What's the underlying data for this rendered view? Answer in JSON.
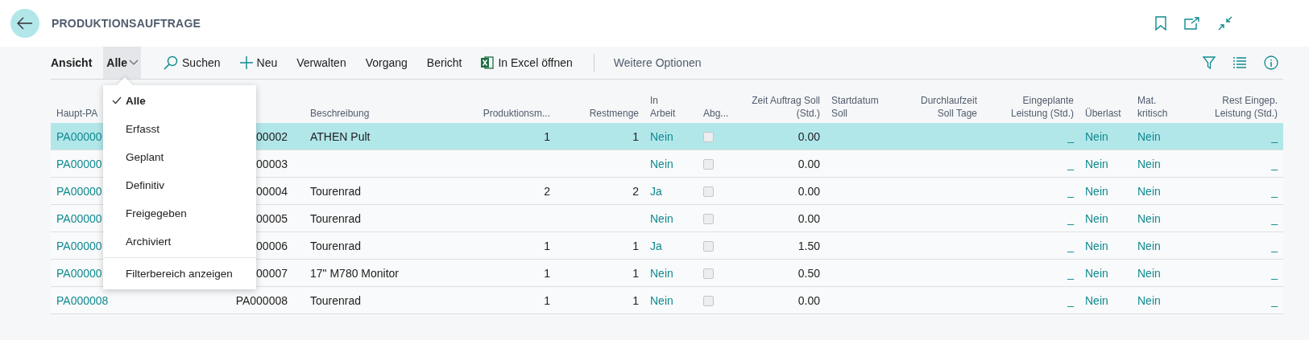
{
  "page": {
    "title": "PRODUKTIONSAUFTRAGE"
  },
  "toolbar": {
    "items": [
      {
        "kind": "label",
        "label": "Ansicht"
      },
      {
        "kind": "dropdown",
        "label": "Alle",
        "expanded": true
      },
      {
        "kind": "search",
        "label": "Suchen"
      },
      {
        "kind": "new",
        "label": "Neu"
      },
      {
        "kind": "text",
        "label": "Verwalten"
      },
      {
        "kind": "text",
        "label": "Vorgang"
      },
      {
        "kind": "text",
        "label": "Bericht"
      },
      {
        "kind": "excel",
        "label": "In Excel öffnen"
      },
      {
        "kind": "more",
        "label": "Weitere Optionen"
      }
    ]
  },
  "view_menu": {
    "items": [
      {
        "label": "Alle",
        "selected": true
      },
      {
        "label": "Erfasst",
        "selected": false
      },
      {
        "label": "Geplant",
        "selected": false
      },
      {
        "label": "Definitiv",
        "selected": false
      },
      {
        "label": "Freigegeben",
        "selected": false
      },
      {
        "label": "Archiviert",
        "selected": false
      }
    ],
    "footer": "Filterbereich anzeigen"
  },
  "table": {
    "columns": [
      {
        "label": "Haupt-PA",
        "kind": "link"
      },
      {
        "kind": "text"
      },
      {
        "kind": "code"
      },
      {
        "label": "Beschreibung",
        "kind": "text"
      },
      {
        "label": "Produktionsm...",
        "kind": "number"
      },
      {
        "label": "Restmenge",
        "kind": "number"
      },
      {
        "label": "In\nArbeit",
        "kind": "link"
      },
      {
        "label": "Abg...",
        "kind": "checkbox"
      },
      {
        "label": "Zeit Auftrag Soll\n(Std.)",
        "kind": "number"
      },
      {
        "label": "Startdatum\nSoll",
        "kind": "text"
      },
      {
        "label": "Durchlaufzeit\nSoll Tage",
        "kind": "number"
      },
      {
        "label": "Eingeplante\nLeistung (Std.)",
        "kind": "numlink"
      },
      {
        "label": "Überlast",
        "kind": "link"
      },
      {
        "label": "Mat.\nkritisch",
        "kind": "link"
      },
      {
        "label": "Rest Eingep.\nLeistung (Std.)",
        "kind": "numlink"
      }
    ],
    "rows": [
      {
        "selected": true,
        "cells": [
          "PA00000",
          null,
          "00002",
          "ATHEN Pult",
          "1",
          "1",
          "Nein",
          false,
          "0.00",
          null,
          null,
          "_",
          "Nein",
          "Nein",
          "_"
        ]
      },
      {
        "selected": false,
        "cells": [
          "PA00000",
          null,
          "00003",
          null,
          null,
          null,
          "Nein",
          false,
          "0.00",
          null,
          null,
          "_",
          "Nein",
          "Nein",
          "_"
        ]
      },
      {
        "selected": false,
        "cells": [
          "PA00000",
          null,
          "00004",
          "Tourenrad",
          "2",
          "2",
          "Ja",
          false,
          "0.00",
          null,
          null,
          "_",
          "Nein",
          "Nein",
          "_"
        ]
      },
      {
        "selected": false,
        "cells": [
          "PA00000",
          null,
          "00005",
          "Tourenrad",
          null,
          null,
          "Nein",
          false,
          "0.00",
          null,
          null,
          "_",
          "Nein",
          "Nein",
          "_"
        ]
      },
      {
        "selected": false,
        "cells": [
          "PA00000",
          null,
          "00006",
          "Tourenrad",
          "1",
          "1",
          "Ja",
          false,
          "1.50",
          null,
          null,
          "_",
          "Nein",
          "Nein",
          "_"
        ]
      },
      {
        "selected": false,
        "cells": [
          "PA00000",
          null,
          "00007",
          "17\" M780 Monitor",
          "1",
          "1",
          "Nein",
          false,
          "0.50",
          null,
          null,
          "_",
          "Nein",
          "Nein",
          "_"
        ]
      },
      {
        "selected": false,
        "cells": [
          "PA000008",
          null,
          "PA000008",
          "Tourenrad",
          "1",
          "1",
          "Nein",
          false,
          "0.00",
          null,
          null,
          "_",
          "Nein",
          "Nein",
          "_"
        ]
      }
    ]
  }
}
